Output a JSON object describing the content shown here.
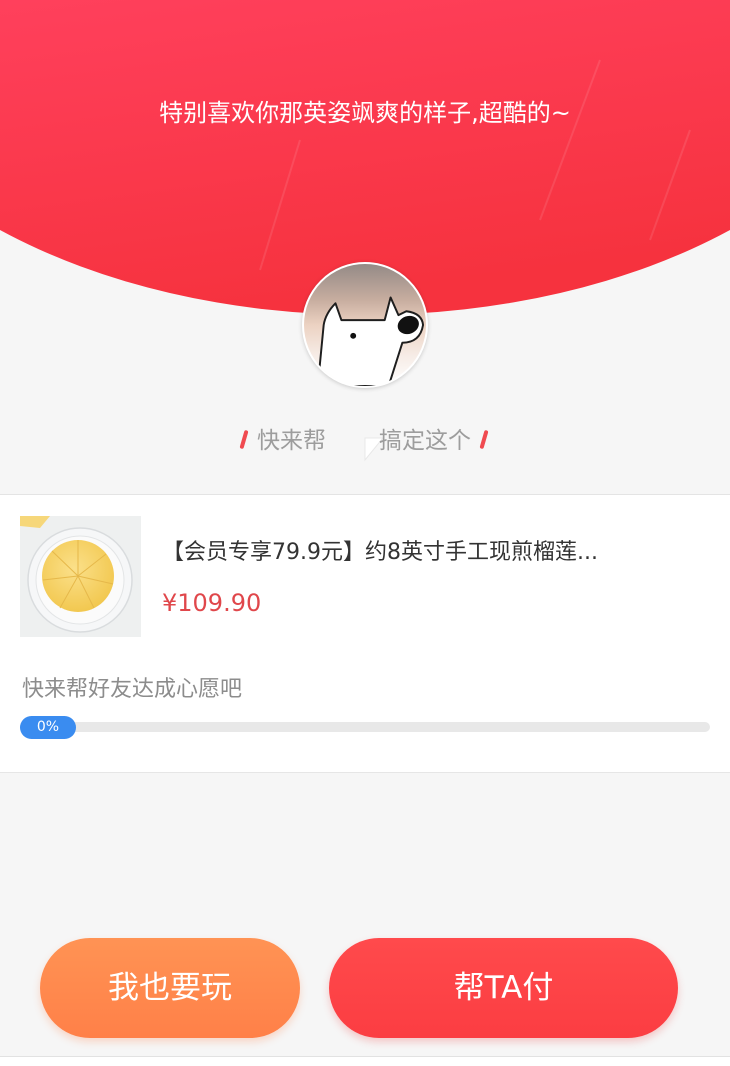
{
  "header": {
    "message": "特别喜欢你那英姿飒爽的样子,超酷的~",
    "background_icon": "red-arc-banner"
  },
  "avatar": {
    "icon": "dog-avatar"
  },
  "invite": {
    "prefix": "快来帮",
    "suffix": "搞定这个"
  },
  "product": {
    "image_icon": "durian-cake-image",
    "title": "【会员专享79.9元】约8英寸手工现煎榴莲...",
    "price": "¥109.90"
  },
  "progress": {
    "label": "快来帮好友达成心愿吧",
    "percent_text": "0%",
    "value": 0
  },
  "actions": {
    "play_label": "我也要玩",
    "pay_label": "帮TA付"
  },
  "colors": {
    "header_red": "#ff3d55",
    "price_red": "#e0474b",
    "play_orange": "#ff8a4d",
    "pay_red": "#ff4448",
    "progress_blue": "#3a8cf0"
  }
}
